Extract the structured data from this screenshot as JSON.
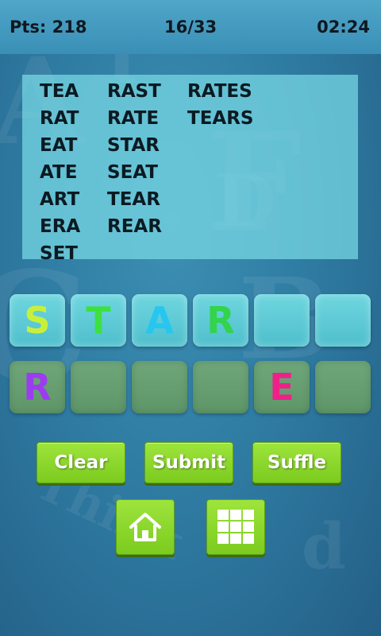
{
  "header": {
    "points": "Pts: 218",
    "progress": "16/33",
    "timer": "02:24"
  },
  "found_words": {
    "columns": [
      [
        "TEA",
        "RAT",
        "EAT",
        "ATE",
        "ART",
        "ERA",
        "SET"
      ],
      [
        "RAST",
        "RATE",
        "STAR",
        "SEAT",
        "TEAR",
        "REAR"
      ],
      [
        "RATES",
        "TEARS"
      ]
    ]
  },
  "answer_tiles": [
    {
      "letter": "S",
      "color": "#c8f03a"
    },
    {
      "letter": "T",
      "color": "#3ee040"
    },
    {
      "letter": "A",
      "color": "#26c6f0"
    },
    {
      "letter": "R",
      "color": "#33d34c"
    },
    {
      "letter": "",
      "color": ""
    },
    {
      "letter": "",
      "color": ""
    }
  ],
  "letter_pool": [
    {
      "letter": "R",
      "color": "#9b3cf0"
    },
    {
      "letter": "",
      "color": ""
    },
    {
      "letter": "",
      "color": ""
    },
    {
      "letter": "",
      "color": ""
    },
    {
      "letter": "E",
      "color": "#f0208a"
    },
    {
      "letter": "",
      "color": ""
    }
  ],
  "buttons": {
    "clear": "Clear",
    "submit": "Submit",
    "shuffle": "Suffle"
  },
  "icons": {
    "home": "home-icon",
    "menu": "grid-menu-icon"
  },
  "colors": {
    "button_green": "#8bd52a",
    "panel": "#78dae4",
    "background": "#2f7ca3"
  }
}
